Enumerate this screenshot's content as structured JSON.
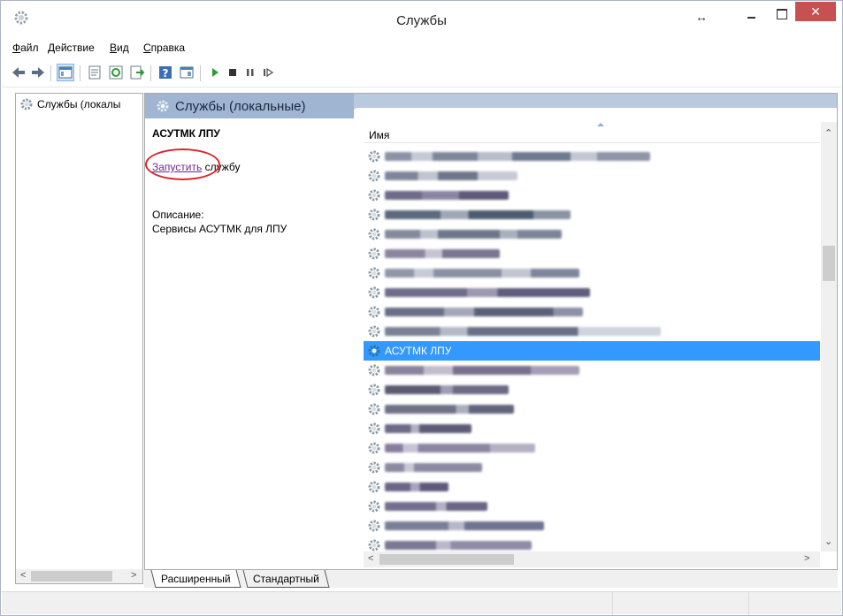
{
  "window": {
    "title": "Службы",
    "resize_glyph": "↔",
    "close_glyph": "✕"
  },
  "menu": [
    {
      "key": "Ф",
      "rest": "айл"
    },
    {
      "key": "Д",
      "rest": "ействие"
    },
    {
      "key": "В",
      "rest": "ид"
    },
    {
      "key": "С",
      "rest": "правка"
    }
  ],
  "toolbar": {
    "icons": [
      "back-icon",
      "forward-icon",
      "console-tree-icon",
      "properties-icon",
      "refresh-icon",
      "export-list-icon",
      "help-icon",
      "show-action-pane-icon",
      "start-service-icon",
      "stop-service-icon",
      "pause-service-icon",
      "restart-service-icon"
    ]
  },
  "tree": {
    "root_label": "Службы (локалы"
  },
  "pane": {
    "header": "Службы (локальные)"
  },
  "details": {
    "service_name": "АСУТМК ЛПУ",
    "start_link": "Запустить",
    "start_rest": " службу",
    "description_label": "Описание:",
    "description": "Сервисы АСУТМК для ЛПУ"
  },
  "list": {
    "column_name": "Имя",
    "selected_service": "АСУТМК ЛПУ"
  },
  "view_tabs": {
    "extended": "Расширенный",
    "standard": "Стандартный"
  },
  "colors": {
    "selection": "#3399ff",
    "pane_header": "#9fb5d1",
    "close_button": "#c75050",
    "highlight_circle": "#d8262a"
  }
}
